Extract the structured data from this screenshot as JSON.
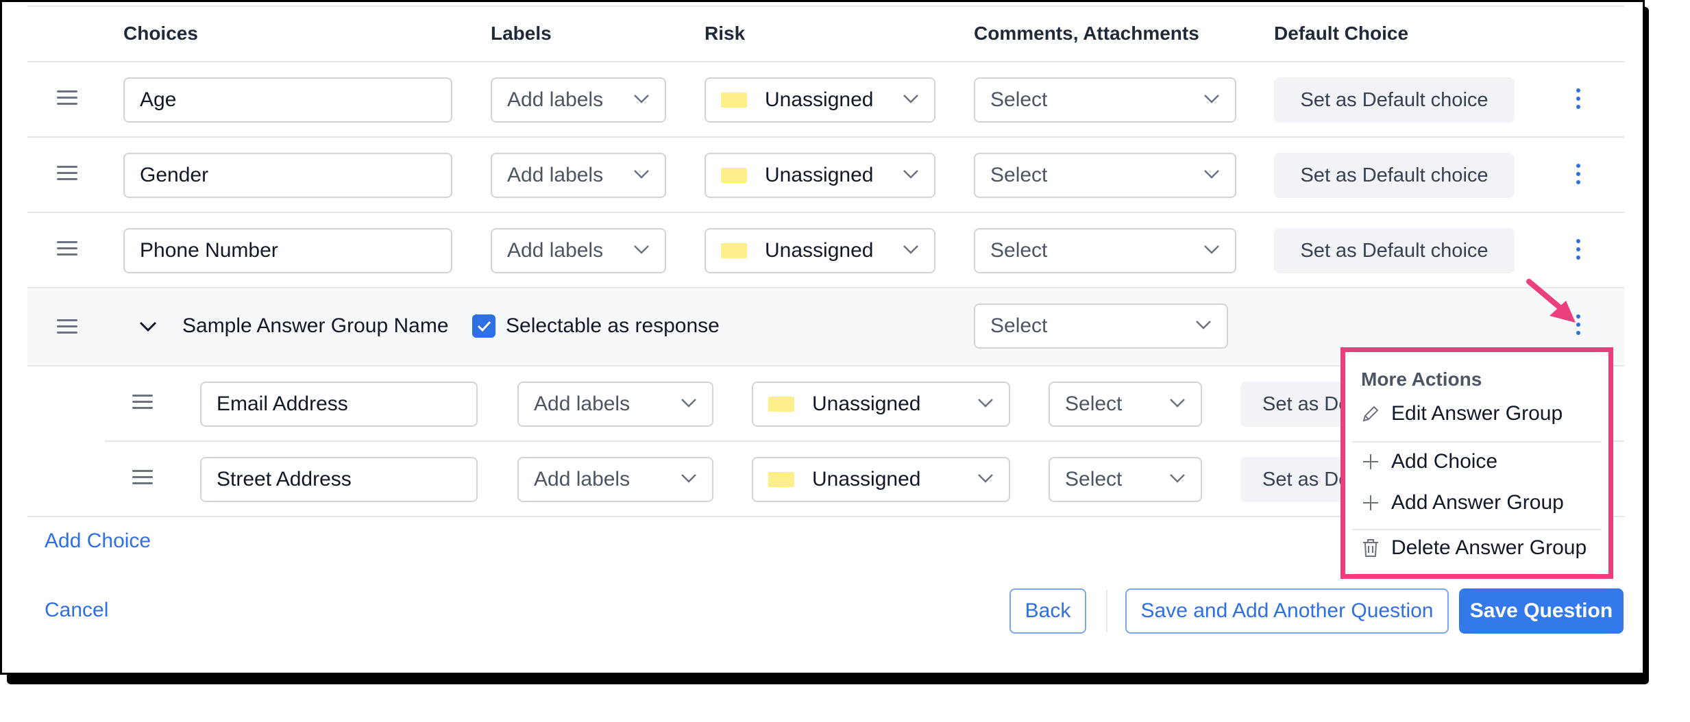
{
  "columns": {
    "choices": "Choices",
    "labels": "Labels",
    "risk": "Risk",
    "comments": "Comments, Attachments",
    "default": "Default Choice"
  },
  "rows": [
    {
      "choice": "Age",
      "labels": "Add labels",
      "risk": "Unassigned",
      "comments": "Select",
      "default": "Set as Default choice"
    },
    {
      "choice": "Gender",
      "labels": "Add labels",
      "risk": "Unassigned",
      "comments": "Select",
      "default": "Set as Default choice"
    },
    {
      "choice": "Phone Number",
      "labels": "Add labels",
      "risk": "Unassigned",
      "comments": "Select",
      "default": "Set as Default choice"
    }
  ],
  "group": {
    "name": "Sample Answer Group Name",
    "selectable_label": "Selectable as response",
    "selectable_checked": true,
    "comments": "Select",
    "children": [
      {
        "choice": "Email Address",
        "labels": "Add labels",
        "risk": "Unassigned",
        "comments": "Select",
        "default": "Set as De"
      },
      {
        "choice": "Street Address",
        "labels": "Add labels",
        "risk": "Unassigned",
        "comments": "Select",
        "default": "Set as De"
      }
    ]
  },
  "menu": {
    "title": "More Actions",
    "items": [
      "Edit Answer Group",
      "Add Choice",
      "Add Answer Group",
      "Delete Answer Group"
    ]
  },
  "footer": {
    "add_choice": "Add Choice",
    "cancel": "Cancel",
    "back": "Back",
    "save_add": "Save and Add Another Question",
    "save": "Save Question"
  },
  "colors": {
    "accent": "#2f6fe4",
    "risk_swatch": "#fdf08a",
    "highlight": "#ea3f7c"
  }
}
